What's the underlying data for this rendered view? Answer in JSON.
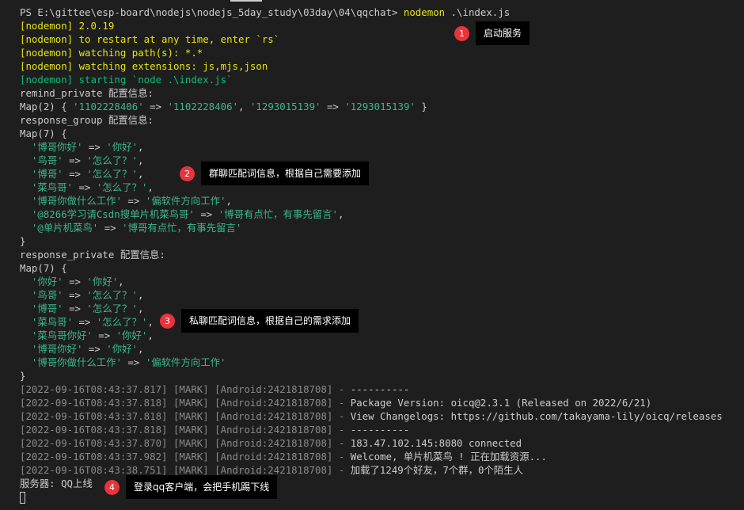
{
  "terminal": {
    "lines": [
      [
        {
          "t": "PS E:\\gittee\\esp-board\\nodejs\\nodejs_5day_study\\03day\\04\\qqchat> ",
          "c": "white"
        },
        {
          "t": "nodemon",
          "c": "yellow"
        },
        {
          "t": " .\\index.js",
          "c": "white"
        }
      ],
      [
        {
          "t": "[nodemon] 2.0.19",
          "c": "yellow"
        }
      ],
      [
        {
          "t": "[nodemon] to restart at any time, enter `rs`",
          "c": "yellow"
        }
      ],
      [
        {
          "t": "[nodemon] watching path(s): *.*",
          "c": "yellow"
        }
      ],
      [
        {
          "t": "[nodemon] watching extensions: js,mjs,json",
          "c": "yellow"
        }
      ],
      [
        {
          "t": "[nodemon] starting `node .\\index.js`",
          "c": "green"
        }
      ],
      [
        {
          "t": "remind_private 配置信息:",
          "c": "white"
        }
      ],
      [
        {
          "t": "Map(2) { ",
          "c": "white"
        },
        {
          "t": "'1102228406'",
          "c": "str"
        },
        {
          "t": " => ",
          "c": "white"
        },
        {
          "t": "'1102228406'",
          "c": "str"
        },
        {
          "t": ", ",
          "c": "white"
        },
        {
          "t": "'1293015139'",
          "c": "str"
        },
        {
          "t": " => ",
          "c": "white"
        },
        {
          "t": "'1293015139'",
          "c": "str"
        },
        {
          "t": " }",
          "c": "white"
        }
      ],
      [
        {
          "t": "response_group 配置信息:",
          "c": "white"
        }
      ],
      [
        {
          "t": "Map(7) {",
          "c": "white"
        }
      ],
      [
        {
          "t": "  ",
          "c": "white"
        },
        {
          "t": "'博哥你好'",
          "c": "str"
        },
        {
          "t": " => ",
          "c": "white"
        },
        {
          "t": "'你好'",
          "c": "str"
        },
        {
          "t": ",",
          "c": "white"
        }
      ],
      [
        {
          "t": "  ",
          "c": "white"
        },
        {
          "t": "'鸟哥'",
          "c": "str"
        },
        {
          "t": " => ",
          "c": "white"
        },
        {
          "t": "'怎么了？'",
          "c": "str"
        },
        {
          "t": ",",
          "c": "white"
        }
      ],
      [
        {
          "t": "  ",
          "c": "white"
        },
        {
          "t": "'博哥'",
          "c": "str"
        },
        {
          "t": " => ",
          "c": "white"
        },
        {
          "t": "'怎么了？'",
          "c": "str"
        },
        {
          "t": ",",
          "c": "white"
        }
      ],
      [
        {
          "t": "  ",
          "c": "white"
        },
        {
          "t": "'菜鸟哥'",
          "c": "str"
        },
        {
          "t": " => ",
          "c": "white"
        },
        {
          "t": "'怎么了？'",
          "c": "str"
        },
        {
          "t": ",",
          "c": "white"
        }
      ],
      [
        {
          "t": "  ",
          "c": "white"
        },
        {
          "t": "'博哥你做什么工作'",
          "c": "str"
        },
        {
          "t": " => ",
          "c": "white"
        },
        {
          "t": "'偏软件方向工作'",
          "c": "str"
        },
        {
          "t": ",",
          "c": "white"
        }
      ],
      [
        {
          "t": "  ",
          "c": "white"
        },
        {
          "t": "'@8266学习请Csdn搜单片机菜鸟哥'",
          "c": "str"
        },
        {
          "t": " => ",
          "c": "white"
        },
        {
          "t": "'博哥有点忙，有事先留言'",
          "c": "str"
        },
        {
          "t": ",",
          "c": "white"
        }
      ],
      [
        {
          "t": "  ",
          "c": "white"
        },
        {
          "t": "'@单片机菜鸟'",
          "c": "str"
        },
        {
          "t": " => ",
          "c": "white"
        },
        {
          "t": "'博哥有点忙，有事先留言'",
          "c": "str"
        }
      ],
      [
        {
          "t": "}",
          "c": "white"
        }
      ],
      [
        {
          "t": "response_private 配置信息:",
          "c": "white"
        }
      ],
      [
        {
          "t": "Map(7) {",
          "c": "white"
        }
      ],
      [
        {
          "t": "  ",
          "c": "white"
        },
        {
          "t": "'你好'",
          "c": "str"
        },
        {
          "t": " => ",
          "c": "white"
        },
        {
          "t": "'你好'",
          "c": "str"
        },
        {
          "t": ",",
          "c": "white"
        }
      ],
      [
        {
          "t": "  ",
          "c": "white"
        },
        {
          "t": "'鸟哥'",
          "c": "str"
        },
        {
          "t": " => ",
          "c": "white"
        },
        {
          "t": "'怎么了？'",
          "c": "str"
        },
        {
          "t": ",",
          "c": "white"
        }
      ],
      [
        {
          "t": "  ",
          "c": "white"
        },
        {
          "t": "'博哥'",
          "c": "str"
        },
        {
          "t": " => ",
          "c": "white"
        },
        {
          "t": "'怎么了？'",
          "c": "str"
        },
        {
          "t": ",",
          "c": "white"
        }
      ],
      [
        {
          "t": "  ",
          "c": "white"
        },
        {
          "t": "'菜鸟哥'",
          "c": "str"
        },
        {
          "t": " => ",
          "c": "white"
        },
        {
          "t": "'怎么了？'",
          "c": "str"
        },
        {
          "t": ",",
          "c": "white"
        }
      ],
      [
        {
          "t": "  ",
          "c": "white"
        },
        {
          "t": "'菜鸟哥你好'",
          "c": "str"
        },
        {
          "t": " => ",
          "c": "white"
        },
        {
          "t": "'你好'",
          "c": "str"
        },
        {
          "t": ",",
          "c": "white"
        }
      ],
      [
        {
          "t": "  ",
          "c": "white"
        },
        {
          "t": "'博哥你好'",
          "c": "str"
        },
        {
          "t": " => ",
          "c": "white"
        },
        {
          "t": "'你好'",
          "c": "str"
        },
        {
          "t": ",",
          "c": "white"
        }
      ],
      [
        {
          "t": "  ",
          "c": "white"
        },
        {
          "t": "'博哥你做什么工作'",
          "c": "str"
        },
        {
          "t": " => ",
          "c": "white"
        },
        {
          "t": "'偏软件方向工作'",
          "c": "str"
        }
      ],
      [
        {
          "t": "}",
          "c": "white"
        }
      ],
      [
        {
          "t": "[2022-09-16T08:43:37.817] [MARK] [Android:2421818708] - ",
          "c": "gray"
        },
        {
          "t": "----------",
          "c": "white"
        }
      ],
      [
        {
          "t": "[2022-09-16T08:43:37.818] [MARK] [Android:2421818708] - ",
          "c": "gray"
        },
        {
          "t": "Package Version: oicq@2.3.1 (Released on 2022/6/21)",
          "c": "white"
        }
      ],
      [
        {
          "t": "[2022-09-16T08:43:37.818] [MARK] [Android:2421818708] - ",
          "c": "gray"
        },
        {
          "t": "View Changelogs: https://github.com/takayama-lily/oicq/releases",
          "c": "white"
        }
      ],
      [
        {
          "t": "[2022-09-16T08:43:37.818] [MARK] [Android:2421818708] - ",
          "c": "gray"
        },
        {
          "t": "----------",
          "c": "white"
        }
      ],
      [
        {
          "t": "[2022-09-16T08:43:37.870] [MARK] [Android:2421818708] - ",
          "c": "gray"
        },
        {
          "t": "183.47.102.145:8080 connected",
          "c": "white"
        }
      ],
      [
        {
          "t": "[2022-09-16T08:43:37.982] [MARK] [Android:2421818708] - ",
          "c": "gray"
        },
        {
          "t": "Welcome, 单片机菜鸟 ! 正在加载资源...",
          "c": "white"
        }
      ],
      [
        {
          "t": "[2022-09-16T08:43:38.751] [MARK] [Android:2421818708] - ",
          "c": "gray"
        },
        {
          "t": "加载了1249个好友，7个群，0个陌生人",
          "c": "white"
        }
      ],
      [
        {
          "t": "服务器: QQ上线",
          "c": "white"
        }
      ]
    ]
  },
  "callouts": [
    {
      "num": "1",
      "text": "启动服务"
    },
    {
      "num": "2",
      "text": "群聊匹配词信息，根据自己需要添加"
    },
    {
      "num": "3",
      "text": "私聊匹配词信息，根据自己的需求添加"
    },
    {
      "num": "4",
      "text": "登录qq客户端，会把手机踢下线"
    }
  ],
  "colors": {
    "background": "#1e1e1e",
    "text": "#cccccc",
    "nodemon_yellow": "#e5e510",
    "nodemon_green": "#0dbc79",
    "string_green": "#3cb98c",
    "log_gray": "#8a8a8a",
    "badge_red": "#e8343a",
    "label_bg": "#000000"
  }
}
